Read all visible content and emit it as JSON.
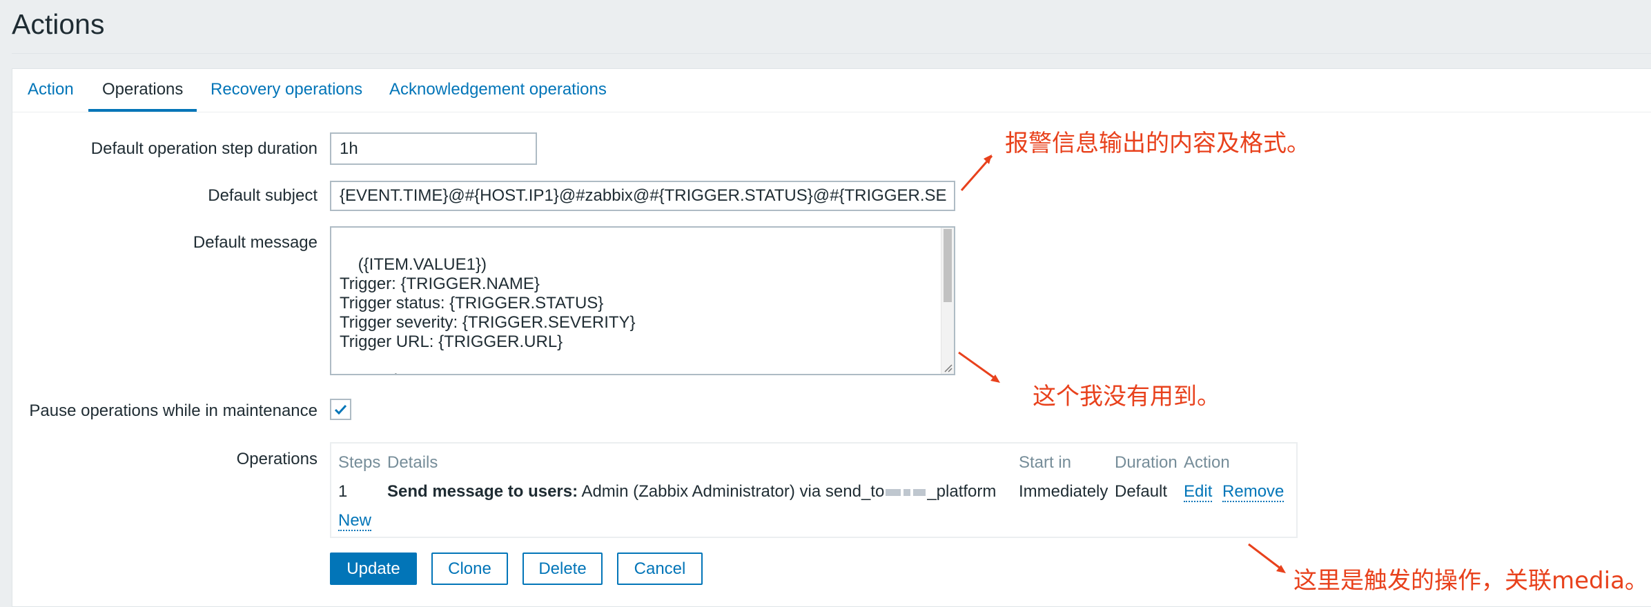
{
  "page": {
    "title": "Actions"
  },
  "tabs": [
    {
      "label": "Action",
      "active": false
    },
    {
      "label": "Operations",
      "active": true
    },
    {
      "label": "Recovery operations",
      "active": false
    },
    {
      "label": "Acknowledgement operations",
      "active": false
    }
  ],
  "form": {
    "step_duration": {
      "label": "Default operation step duration",
      "value": "1h"
    },
    "subject": {
      "label": "Default subject",
      "value": "{EVENT.TIME}@#{HOST.IP1}@#zabbix@#{TRIGGER.STATUS}@#{TRIGGER.SE"
    },
    "message": {
      "label": "Default message",
      "value": "({ITEM.VALUE1})\nTrigger: {TRIGGER.NAME}\nTrigger status: {TRIGGER.STATUS}\nTrigger severity: {TRIGGER.SEVERITY}\nTrigger URL: {TRIGGER.URL}\n\nItem values:"
    },
    "pause": {
      "label": "Pause operations while in maintenance",
      "checked": true
    }
  },
  "operations": {
    "label": "Operations",
    "headers": {
      "steps": "Steps",
      "details": "Details",
      "start_in": "Start in",
      "duration": "Duration",
      "action": "Action"
    },
    "rows": [
      {
        "steps": "1",
        "details_bold": "Send message to users:",
        "details_prefix": "Admin (Zabbix Administrator) via send_to",
        "details_suffix": "_platform",
        "start_in": "Immediately",
        "duration": "Default",
        "edit": "Edit",
        "remove": "Remove"
      }
    ],
    "new_link": "New"
  },
  "buttons": {
    "update": "Update",
    "clone": "Clone",
    "delete": "Delete",
    "cancel": "Cancel"
  },
  "annotations": {
    "subject_note": "报警信息输出的内容及格式。",
    "message_note": "这个我没有用到。",
    "operations_note": "这里是触发的操作，关联media。"
  },
  "colors": {
    "accent": "#0275b8",
    "annotation": "#e8411c",
    "text": "#1f2c33",
    "muted": "#768d99"
  }
}
